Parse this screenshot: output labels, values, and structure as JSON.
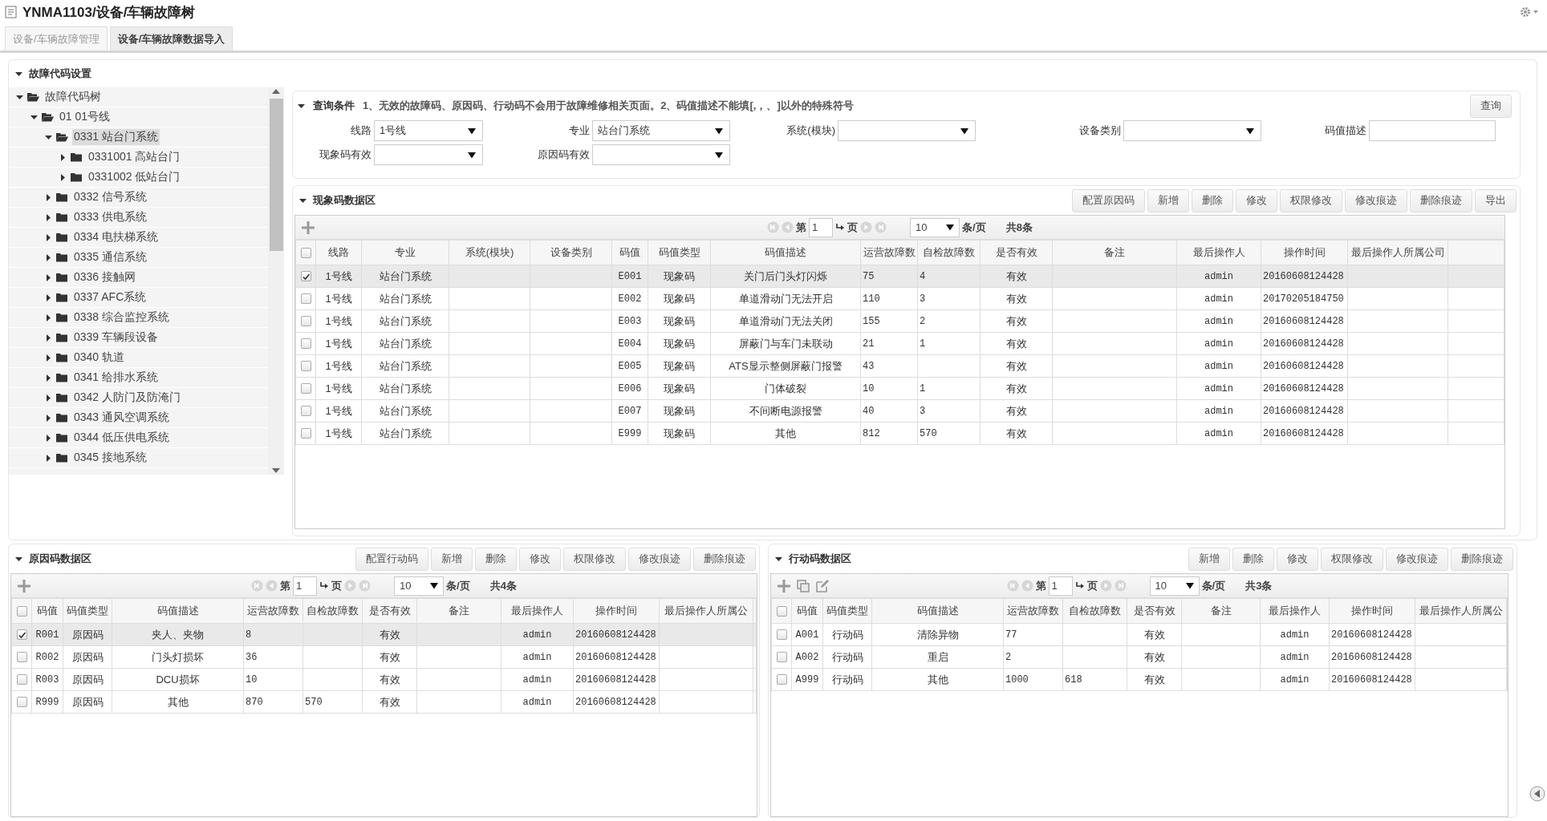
{
  "window": {
    "title": "YNMA1103/设备/车辆故障树"
  },
  "tabs": [
    {
      "label": "设备/车辆故障管理",
      "selected": false
    },
    {
      "label": "设备/车辆故障数据导入",
      "selected": true
    }
  ],
  "settings": {
    "title": "故障代码设置",
    "expanded": true
  },
  "tree": [
    {
      "label": "故障代码树",
      "expanded": true,
      "selected": false,
      "children": [
        {
          "label": "01 01号线",
          "expanded": true,
          "selected": false,
          "children": [
            {
              "label": "0331 站台门系统",
              "expanded": true,
              "selected": true,
              "children": [
                {
                  "label": "0331001 高站台门",
                  "expanded": false,
                  "selected": false
                },
                {
                  "label": "0331002 低站台门",
                  "expanded": false,
                  "selected": false
                }
              ]
            },
            {
              "label": "0332 信号系统",
              "expanded": false,
              "selected": false
            },
            {
              "label": "0333 供电系统",
              "expanded": false,
              "selected": false
            },
            {
              "label": "0334 电扶梯系统",
              "expanded": false,
              "selected": false
            },
            {
              "label": "0335 通信系统",
              "expanded": false,
              "selected": false
            },
            {
              "label": "0336 接触网",
              "expanded": false,
              "selected": false
            },
            {
              "label": "0337 AFC系统",
              "expanded": false,
              "selected": false
            },
            {
              "label": "0338 综合监控系统",
              "expanded": false,
              "selected": false
            },
            {
              "label": "0339 车辆段设备",
              "expanded": false,
              "selected": false
            },
            {
              "label": "0340 轨道",
              "expanded": false,
              "selected": false
            },
            {
              "label": "0341 给排水系统",
              "expanded": false,
              "selected": false
            },
            {
              "label": "0342 人防门及防淹门",
              "expanded": false,
              "selected": false
            },
            {
              "label": "0343 通风空调系统",
              "expanded": false,
              "selected": false
            },
            {
              "label": "0344 低压供电系统",
              "expanded": false,
              "selected": false
            },
            {
              "label": "0345 接地系统",
              "expanded": false,
              "selected": false
            }
          ]
        }
      ]
    }
  ],
  "query": {
    "title": "查询条件",
    "expanded": true,
    "note": "1、无效的故障码、原因码、行动码不会用于故障维修相关页面。2、码值描述不能填[,，、]以外的特殊符号",
    "button": "查询",
    "fields": [
      {
        "label": "线路",
        "kind": "select",
        "value": "1号线"
      },
      {
        "label": "专业",
        "kind": "select",
        "value": "站台门系统"
      },
      {
        "label": "系统(模块)",
        "kind": "select"
      },
      {
        "label": "设备类别",
        "kind": "select"
      },
      {
        "label": "码值描述",
        "kind": "text"
      },
      {
        "label": "现象码有效",
        "kind": "select"
      },
      {
        "label": "原因码有效",
        "kind": "select"
      }
    ]
  },
  "symptom_area": {
    "title": "现象码数据区",
    "expanded": true,
    "buttons": [
      "配置原因码",
      "新增",
      "删除",
      "修改",
      "权限修改",
      "修改痕迹",
      "删除痕迹",
      "导出"
    ],
    "tools": [
      {
        "kind": "add"
      }
    ],
    "pager": {
      "page_prefix": "第",
      "page": "1",
      "page_suffix": "页",
      "page_size": "10",
      "per_page": "条/页",
      "total": "共8条"
    },
    "header_checked": false,
    "columns": [
      "线路",
      "专业",
      "系统(模块)",
      "设备类别",
      "码值",
      "码值类型",
      "码值描述",
      "运营故障数",
      "自检故障数",
      "是否有效",
      "备注",
      "最后操作人",
      "操作时间",
      "最后操作人所属公司"
    ],
    "rows": [
      {
        "selected": true,
        "cells": [
          "1号线",
          "站台门系统",
          null,
          null,
          "E001",
          "现象码",
          "关门后门头灯闪烁",
          "75",
          "4",
          "有效",
          null,
          "admin",
          "20160608124428",
          null
        ]
      },
      {
        "selected": false,
        "cells": [
          "1号线",
          "站台门系统",
          null,
          null,
          "E002",
          "现象码",
          "单道滑动门无法开启",
          "110",
          "3",
          "有效",
          null,
          "admin",
          "20170205184750",
          null
        ]
      },
      {
        "selected": false,
        "cells": [
          "1号线",
          "站台门系统",
          null,
          null,
          "E003",
          "现象码",
          "单道滑动门无法关闭",
          "155",
          "2",
          "有效",
          null,
          "admin",
          "20160608124428",
          null
        ]
      },
      {
        "selected": false,
        "cells": [
          "1号线",
          "站台门系统",
          null,
          null,
          "E004",
          "现象码",
          "屏蔽门与车门未联动",
          "21",
          "1",
          "有效",
          null,
          "admin",
          "20160608124428",
          null
        ]
      },
      {
        "selected": false,
        "cells": [
          "1号线",
          "站台门系统",
          null,
          null,
          "E005",
          "现象码",
          "ATS显示整侧屏蔽门报警",
          "43",
          null,
          "有效",
          null,
          "admin",
          "20160608124428",
          null
        ]
      },
      {
        "selected": false,
        "cells": [
          "1号线",
          "站台门系统",
          null,
          null,
          "E006",
          "现象码",
          "门体破裂",
          "10",
          "1",
          "有效",
          null,
          "admin",
          "20160608124428",
          null
        ]
      },
      {
        "selected": false,
        "cells": [
          "1号线",
          "站台门系统",
          null,
          null,
          "E007",
          "现象码",
          "不间断电源报警",
          "40",
          "3",
          "有效",
          null,
          "admin",
          "20160608124428",
          null
        ]
      },
      {
        "selected": false,
        "cells": [
          "1号线",
          "站台门系统",
          null,
          null,
          "E999",
          "现象码",
          "其他",
          "812",
          "570",
          "有效",
          null,
          "admin",
          "20160608124428",
          null
        ]
      }
    ]
  },
  "cause_area": {
    "title": "原因码数据区",
    "expanded": true,
    "buttons": [
      "配置行动码",
      "新增",
      "删除",
      "修改",
      "权限修改",
      "修改痕迹",
      "删除痕迹"
    ],
    "tools": [
      {
        "kind": "add"
      }
    ],
    "pager": {
      "page_prefix": "第",
      "page": "1",
      "page_suffix": "页",
      "page_size": "10",
      "per_page": "条/页",
      "total": "共4条"
    },
    "header_checked": false,
    "columns": [
      "码值",
      "码值类型",
      "码值描述",
      "运营故障数",
      "自检故障数",
      "是否有效",
      "备注",
      "最后操作人",
      "操作时间",
      "最后操作人所属公"
    ],
    "rows": [
      {
        "selected": true,
        "cells": [
          "R001",
          "原因码",
          "夹人、夹物",
          "8",
          null,
          "有效",
          null,
          "admin",
          "20160608124428",
          null
        ]
      },
      {
        "selected": false,
        "cells": [
          "R002",
          "原因码",
          "门头灯损坏",
          "36",
          null,
          "有效",
          null,
          "admin",
          "20160608124428",
          null
        ]
      },
      {
        "selected": false,
        "cells": [
          "R003",
          "原因码",
          "DCU损坏",
          "10",
          null,
          "有效",
          null,
          "admin",
          "20160608124428",
          null
        ]
      },
      {
        "selected": false,
        "cells": [
          "R999",
          "原因码",
          "其他",
          "870",
          "570",
          "有效",
          null,
          "admin",
          "20160608124428",
          null
        ]
      }
    ]
  },
  "action_area": {
    "title": "行动码数据区",
    "expanded": true,
    "buttons": [
      "新增",
      "删除",
      "修改",
      "权限修改",
      "修改痕迹",
      "删除痕迹"
    ],
    "tools": [
      {
        "kind": "add"
      },
      {
        "kind": "copy"
      },
      {
        "kind": "edit"
      }
    ],
    "pager": {
      "page_prefix": "第",
      "page": "1",
      "page_suffix": "页",
      "page_size": "10",
      "per_page": "条/页",
      "total": "共3条"
    },
    "header_checked": false,
    "columns": [
      "码值",
      "码值类型",
      "码值描述",
      "运营故障数",
      "自检故障数",
      "是否有效",
      "备注",
      "最后操作人",
      "操作时间",
      "最后操作人所属公"
    ],
    "rows": [
      {
        "selected": false,
        "cells": [
          "A001",
          "行动码",
          "清除异物",
          "77",
          null,
          "有效",
          null,
          "admin",
          "20160608124428",
          null
        ]
      },
      {
        "selected": false,
        "cells": [
          "A002",
          "行动码",
          "重启",
          "2",
          null,
          "有效",
          null,
          "admin",
          "20160608124428",
          null
        ]
      },
      {
        "selected": false,
        "cells": [
          "A999",
          "行动码",
          "其他",
          "1000",
          "618",
          "有效",
          null,
          "admin",
          "20160608124428",
          null
        ]
      }
    ]
  }
}
